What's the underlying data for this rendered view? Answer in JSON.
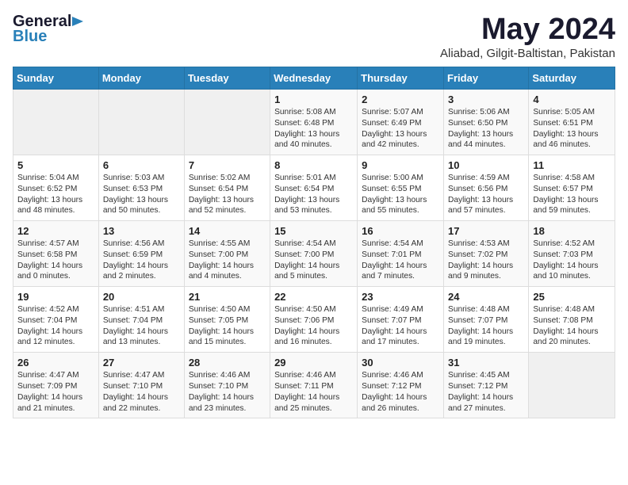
{
  "logo": {
    "general": "General",
    "blue": "Blue"
  },
  "title": "May 2024",
  "location": "Aliabad, Gilgit-Baltistan, Pakistan",
  "days_of_week": [
    "Sunday",
    "Monday",
    "Tuesday",
    "Wednesday",
    "Thursday",
    "Friday",
    "Saturday"
  ],
  "weeks": [
    [
      {
        "day": null
      },
      {
        "day": null
      },
      {
        "day": null
      },
      {
        "day": "1",
        "sunrise": "5:08 AM",
        "sunset": "6:48 PM",
        "daylight": "13 hours and 40 minutes."
      },
      {
        "day": "2",
        "sunrise": "5:07 AM",
        "sunset": "6:49 PM",
        "daylight": "13 hours and 42 minutes."
      },
      {
        "day": "3",
        "sunrise": "5:06 AM",
        "sunset": "6:50 PM",
        "daylight": "13 hours and 44 minutes."
      },
      {
        "day": "4",
        "sunrise": "5:05 AM",
        "sunset": "6:51 PM",
        "daylight": "13 hours and 46 minutes."
      }
    ],
    [
      {
        "day": "5",
        "sunrise": "5:04 AM",
        "sunset": "6:52 PM",
        "daylight": "13 hours and 48 minutes."
      },
      {
        "day": "6",
        "sunrise": "5:03 AM",
        "sunset": "6:53 PM",
        "daylight": "13 hours and 50 minutes."
      },
      {
        "day": "7",
        "sunrise": "5:02 AM",
        "sunset": "6:54 PM",
        "daylight": "13 hours and 52 minutes."
      },
      {
        "day": "8",
        "sunrise": "5:01 AM",
        "sunset": "6:54 PM",
        "daylight": "13 hours and 53 minutes."
      },
      {
        "day": "9",
        "sunrise": "5:00 AM",
        "sunset": "6:55 PM",
        "daylight": "13 hours and 55 minutes."
      },
      {
        "day": "10",
        "sunrise": "4:59 AM",
        "sunset": "6:56 PM",
        "daylight": "13 hours and 57 minutes."
      },
      {
        "day": "11",
        "sunrise": "4:58 AM",
        "sunset": "6:57 PM",
        "daylight": "13 hours and 59 minutes."
      }
    ],
    [
      {
        "day": "12",
        "sunrise": "4:57 AM",
        "sunset": "6:58 PM",
        "daylight": "14 hours and 0 minutes."
      },
      {
        "day": "13",
        "sunrise": "4:56 AM",
        "sunset": "6:59 PM",
        "daylight": "14 hours and 2 minutes."
      },
      {
        "day": "14",
        "sunrise": "4:55 AM",
        "sunset": "7:00 PM",
        "daylight": "14 hours and 4 minutes."
      },
      {
        "day": "15",
        "sunrise": "4:54 AM",
        "sunset": "7:00 PM",
        "daylight": "14 hours and 5 minutes."
      },
      {
        "day": "16",
        "sunrise": "4:54 AM",
        "sunset": "7:01 PM",
        "daylight": "14 hours and 7 minutes."
      },
      {
        "day": "17",
        "sunrise": "4:53 AM",
        "sunset": "7:02 PM",
        "daylight": "14 hours and 9 minutes."
      },
      {
        "day": "18",
        "sunrise": "4:52 AM",
        "sunset": "7:03 PM",
        "daylight": "14 hours and 10 minutes."
      }
    ],
    [
      {
        "day": "19",
        "sunrise": "4:52 AM",
        "sunset": "7:04 PM",
        "daylight": "14 hours and 12 minutes."
      },
      {
        "day": "20",
        "sunrise": "4:51 AM",
        "sunset": "7:04 PM",
        "daylight": "14 hours and 13 minutes."
      },
      {
        "day": "21",
        "sunrise": "4:50 AM",
        "sunset": "7:05 PM",
        "daylight": "14 hours and 15 minutes."
      },
      {
        "day": "22",
        "sunrise": "4:50 AM",
        "sunset": "7:06 PM",
        "daylight": "14 hours and 16 minutes."
      },
      {
        "day": "23",
        "sunrise": "4:49 AM",
        "sunset": "7:07 PM",
        "daylight": "14 hours and 17 minutes."
      },
      {
        "day": "24",
        "sunrise": "4:48 AM",
        "sunset": "7:07 PM",
        "daylight": "14 hours and 19 minutes."
      },
      {
        "day": "25",
        "sunrise": "4:48 AM",
        "sunset": "7:08 PM",
        "daylight": "14 hours and 20 minutes."
      }
    ],
    [
      {
        "day": "26",
        "sunrise": "4:47 AM",
        "sunset": "7:09 PM",
        "daylight": "14 hours and 21 minutes."
      },
      {
        "day": "27",
        "sunrise": "4:47 AM",
        "sunset": "7:10 PM",
        "daylight": "14 hours and 22 minutes."
      },
      {
        "day": "28",
        "sunrise": "4:46 AM",
        "sunset": "7:10 PM",
        "daylight": "14 hours and 23 minutes."
      },
      {
        "day": "29",
        "sunrise": "4:46 AM",
        "sunset": "7:11 PM",
        "daylight": "14 hours and 25 minutes."
      },
      {
        "day": "30",
        "sunrise": "4:46 AM",
        "sunset": "7:12 PM",
        "daylight": "14 hours and 26 minutes."
      },
      {
        "day": "31",
        "sunrise": "4:45 AM",
        "sunset": "7:12 PM",
        "daylight": "14 hours and 27 minutes."
      },
      {
        "day": null
      }
    ]
  ]
}
